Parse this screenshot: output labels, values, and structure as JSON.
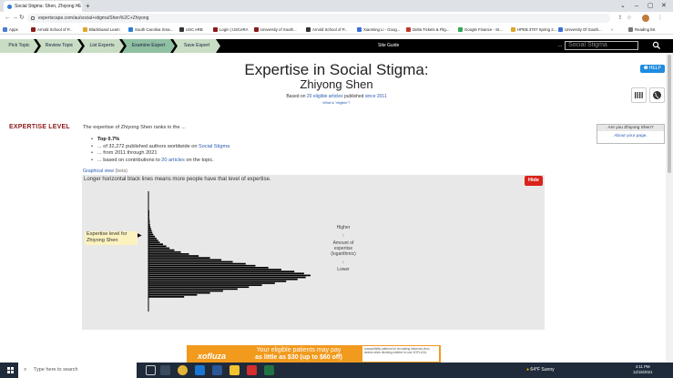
{
  "browser": {
    "tab_title": "Social Stigma: Shen, Zhiyong - E",
    "url": "expertscape.com/au/social+stigma/Shen%2C+Zhiyong",
    "bookmarks": [
      "Apps",
      "Arnold School of P...",
      "Blackboard Learn",
      "South Carolina Sma...",
      "USC eRB",
      "Login | USCeRA",
      "University of South...",
      "Arnold School of P...",
      "Xiaoming Li - Goog...",
      "Delta Tickets & Flig...",
      "Google Finance - St...",
      "HPEB 3707 Spring 2...",
      "University Of South...",
      "Reading list"
    ]
  },
  "site": {
    "crumbs": [
      "Pick Topic",
      "Review Topic",
      "List Experts",
      "Examine Expert",
      "Save Expert"
    ],
    "active_crumb": 3,
    "site_guide": "Site Guide",
    "dots": "...",
    "search_placeholder": "Social Stigma"
  },
  "header": {
    "title": "Expertise in Social Stigma:",
    "name": "Zhiyong Shen",
    "based_prefix": "Based on ",
    "based_articles": "20 eligible articles",
    "based_mid": " published ",
    "based_since": "since 2011",
    "what_eligible": "What is \"eligible\"?",
    "help": "HELP"
  },
  "expertise": {
    "label": "EXPERTISE LEVEL",
    "intro": "The expertise of Zhiyong Shen ranks in the ...",
    "top": "Top 0.7%",
    "authors_prefix": "... of 32,272 published authors worldwide on ",
    "authors_topic": "Social Stigma",
    "years": "... from 2011 through 2021",
    "based_prefix": "... based on contributions to ",
    "based_link": "20 articles",
    "based_suffix": " on the topic.",
    "are_you_title": "Are you Zhiyong Shen?",
    "are_you_link": "About your page."
  },
  "graph": {
    "label": "Graphical view",
    "beta": " (beta)",
    "caption": "Longer horizontal black lines means more people have that level of expertise.",
    "hide": "Hide",
    "level_line1": "Expertise level for",
    "level_line2": "Zhiyong Shen",
    "higher": "Higher",
    "amount1": "Amount of",
    "amount2": "expertise",
    "amount3": "(logarithmic)",
    "lower": "Lower"
  },
  "chart_data": {
    "type": "bar",
    "orientation": "horizontal",
    "description_note": "",
    "bar_lengths_relative": [
      0.002,
      0.003,
      0.004,
      0.004,
      0.006,
      0.008,
      0.008,
      0.01,
      0.012,
      0.016,
      0.02,
      0.024,
      0.03,
      0.04,
      0.05,
      0.06,
      0.07,
      0.09,
      0.11,
      0.13,
      0.16,
      0.2,
      0.25,
      0.31,
      0.38,
      0.45,
      0.52,
      0.6,
      0.66,
      0.74,
      0.82,
      0.9,
      0.96,
      1.0,
      0.97,
      0.92,
      0.85,
      0.78,
      0.7,
      0.62,
      0.55,
      0.46,
      0.38,
      0.3,
      0.22
    ],
    "marker_index": 20,
    "legend": "none",
    "grid": false
  },
  "ad": {
    "brand": "xofluza",
    "line1": "Your eligible patients may pay",
    "line2": "as little as $30 (up to $60 off)",
    "note": "susceptibility patterns for circulating influenza virus strains when deciding whether to use XOFLUZA."
  },
  "taskbar": {
    "search": "Type here to search",
    "weather": "64°F Sunny",
    "time": "4:11 PM",
    "date": "12/15/2021"
  }
}
